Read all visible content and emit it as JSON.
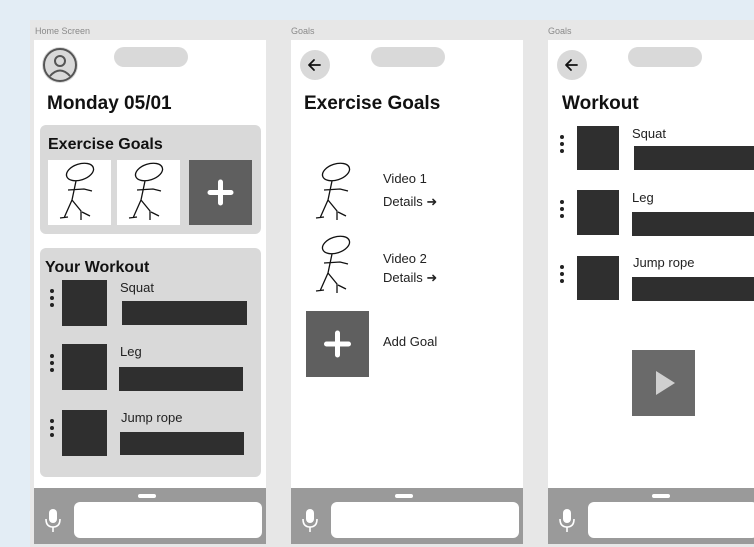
{
  "frames": {
    "home": {
      "label": "Home Screen",
      "date_title": "Monday 05/01",
      "goals_card_title": "Exercise Goals",
      "workout_card_title": "Your Workout",
      "exercises": [
        "Squat",
        "Leg",
        "Jump rope"
      ]
    },
    "goals": {
      "label": "Goals",
      "title": "Exercise Goals",
      "items": [
        {
          "name": "Video 1",
          "details": "Details"
        },
        {
          "name": "Video 2",
          "details": "Details"
        }
      ],
      "add_label": "Add Goal"
    },
    "workout": {
      "label": "Goals",
      "title": "Workout",
      "exercises": [
        "Squat",
        "Leg",
        "Jump rope"
      ]
    }
  },
  "icons": {
    "avatar": "user-avatar-icon",
    "back": "arrow-left-icon",
    "add": "plus-icon",
    "drag": "drag-handle-icon",
    "mic": "microphone-icon",
    "play": "play-icon",
    "details_arrow": "arrow-right-icon"
  },
  "colors": {
    "background": "#e3edf5",
    "board": "#e7e7e7",
    "card": "#d9d9d9",
    "dark_block": "#2f2f2f",
    "button": "#5f5f5f",
    "bottom_bar": "#9a9a9a"
  }
}
